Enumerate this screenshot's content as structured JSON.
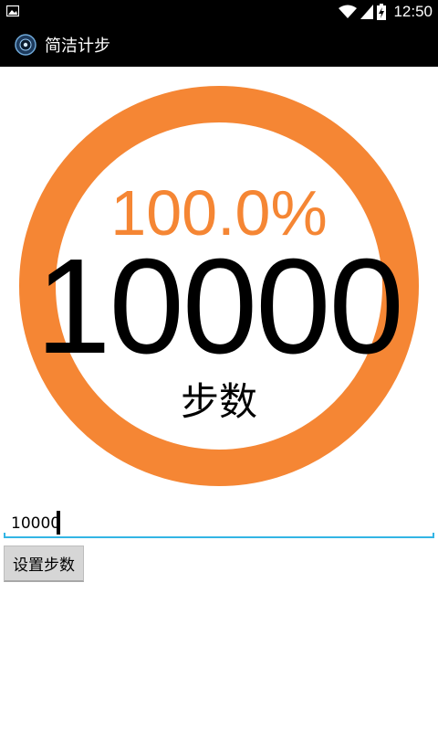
{
  "status_bar": {
    "time": "12:50",
    "icons": [
      "image-notification-icon",
      "wifi-icon",
      "signal-icon",
      "battery-charging-icon"
    ]
  },
  "action_bar": {
    "title": "简洁计步",
    "icon": "app-compass-icon"
  },
  "progress": {
    "percent_text": "100.0%",
    "fraction": 1.0,
    "steps": "10000",
    "unit": "步数",
    "ring_color": "#f58634",
    "percent_color": "#f58634"
  },
  "goal_input": {
    "value": "10000",
    "underline_color": "#33b5e5"
  },
  "set_button": {
    "label": "设置步数"
  }
}
